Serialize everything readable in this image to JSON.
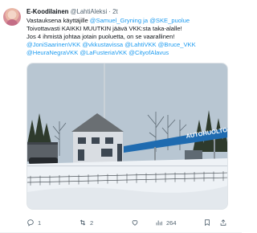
{
  "tweet": {
    "author_name": "E-Koodilainen",
    "author_handle": "@LahtiAleksi",
    "separator": "·",
    "time": "2t",
    "text_lines": [
      [
        {
          "t": "Vastauksena käyttäjille ",
          "link": false
        },
        {
          "t": "@Samuel_Gryning ja @SKE_puolue",
          "link": true
        }
      ],
      [
        {
          "t": "Toivottavasti KAIKKI MUUTKIN jäävä VKK:sta taka-alalle!",
          "link": false
        }
      ],
      [
        {
          "t": "Jos 4 ihmistä johtaa jotain puoluetta, on se vaarallinen!",
          "link": false
        }
      ],
      [
        {
          "t": "@JoniSaarinenVKK @vkkustavissa @LahtiVKK @Bruce_VKK",
          "link": true
        }
      ],
      [
        {
          "t": "@HeuraNegraVKK @LaFusteriaVKK @CityofAlavus",
          "link": true
        }
      ]
    ],
    "image": {
      "sign_text": "AUTOHUOLTO",
      "colors": {
        "sky": "#b8c6d2",
        "building": "#d9dde2",
        "snow": "#eef2f6",
        "canopy": "#1f6bb0",
        "trees": "#2e3a2c"
      }
    },
    "actions": {
      "reply_count": "1",
      "retweet_count": "2",
      "views_count": "264"
    },
    "icons": [
      "reply-icon",
      "retweet-icon",
      "like-icon",
      "views-icon",
      "bookmark-icon",
      "share-icon"
    ]
  }
}
